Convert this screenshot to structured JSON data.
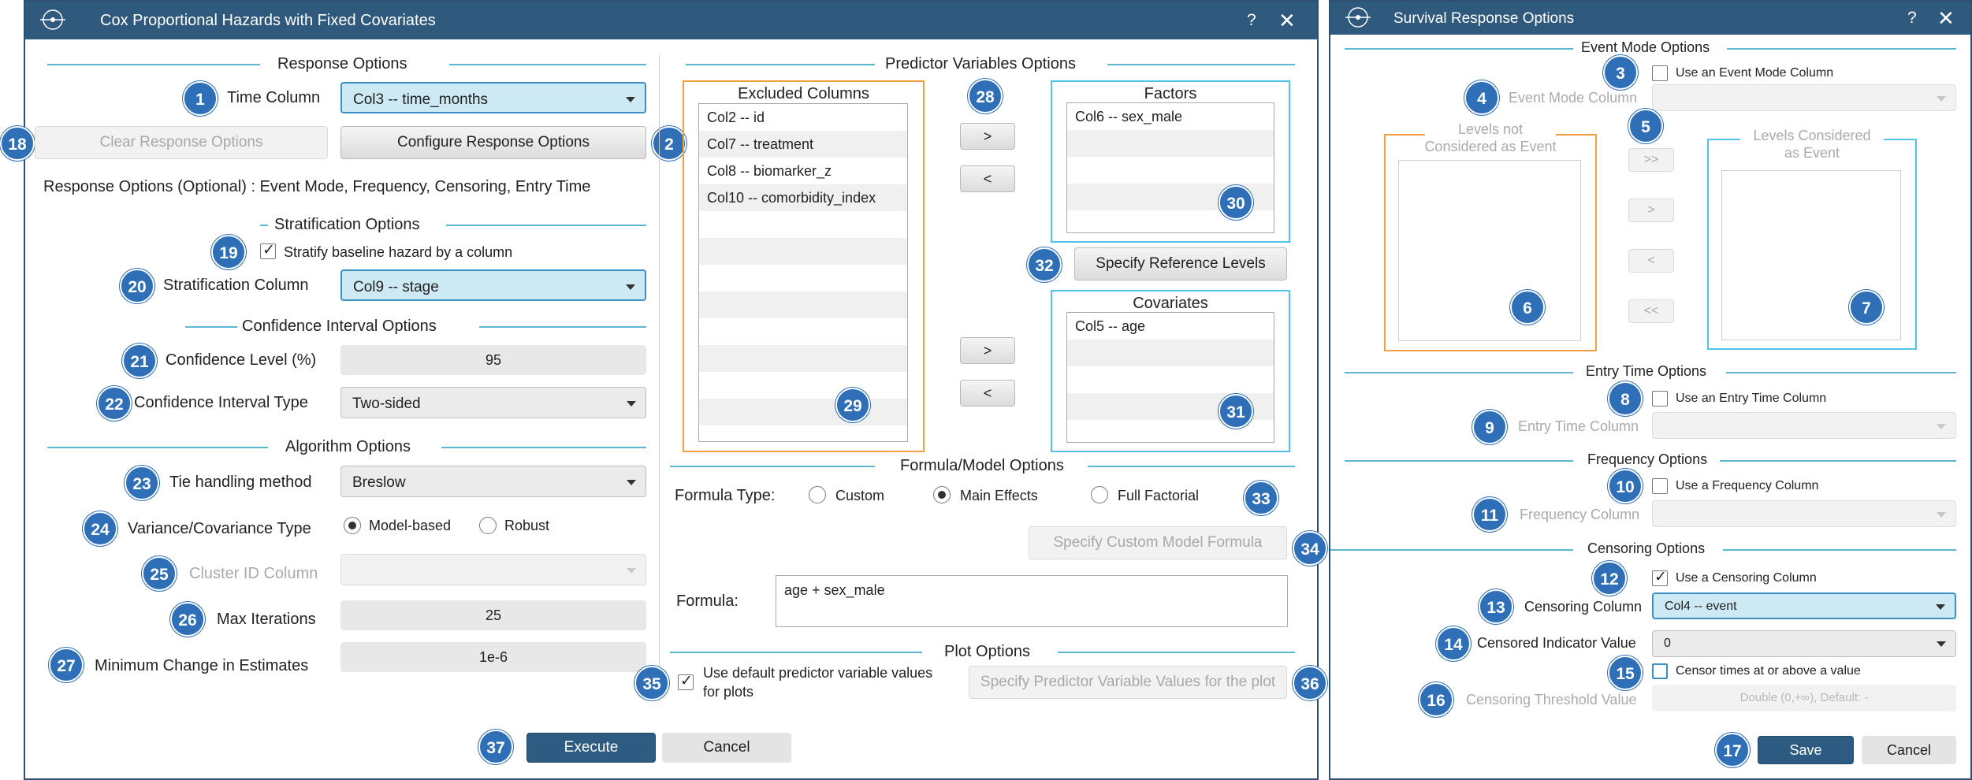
{
  "main": {
    "title": "Cox Proportional Hazards with Fixed Covariates",
    "help": "?",
    "close": "✕",
    "response": {
      "header": "Response Options",
      "time_label": "Time Column",
      "time_value": "Col3 -- time_months",
      "clear_btn": "Clear Response Options",
      "configure_btn": "Configure Response Options",
      "note": "Response Options (Optional) : Event Mode, Frequency, Censoring, Entry Time"
    },
    "strat": {
      "header": "Stratification Options",
      "check_label": "Stratify baseline hazard by a column",
      "col_label": "Stratification Column",
      "col_value": "Col9 -- stage"
    },
    "ci": {
      "header": "Confidence Interval Options",
      "level_label": "Confidence Level (%)",
      "level_value": "95",
      "type_label": "Confidence Interval Type",
      "type_value": "Two-sided"
    },
    "algo": {
      "header": "Algorithm Options",
      "tie_label": "Tie handling method",
      "tie_value": "Breslow",
      "var_label": "Variance/Covariance Type",
      "var_opt1": "Model-based",
      "var_opt2": "Robust",
      "cluster_label": "Cluster ID Column",
      "maxit_label": "Max Iterations",
      "maxit_value": "25",
      "minchg_label": "Minimum Change in Estimates",
      "minchg_value": "1e-6"
    },
    "predictors": {
      "header": "Predictor Variables Options",
      "excluded_title": "Excluded Columns",
      "excluded": [
        "Col2 -- id",
        "Col7 -- treatment",
        "Col8 -- biomarker_z",
        "Col10 -- comorbidity_index"
      ],
      "factors_title": "Factors",
      "factors": [
        "Col6 -- sex_male"
      ],
      "covariates_title": "Covariates",
      "covariates": [
        "Col5 -- age"
      ],
      "move_right": ">",
      "move_left": "<",
      "ref_btn": "Specify Reference Levels"
    },
    "formula": {
      "header": "Formula/Model Options",
      "type_label": "Formula Type:",
      "opt_custom": "Custom",
      "opt_main": "Main Effects",
      "opt_full": "Full Factorial",
      "custom_btn": "Specify Custom Model Formula",
      "formula_label": "Formula:",
      "formula_value": "age + sex_male"
    },
    "plot": {
      "header": "Plot Options",
      "check_label_1": "Use default predictor variable values",
      "check_label_2": "for plots",
      "values_btn": "Specify Predictor Variable Values for the plot"
    },
    "execute_btn": "Execute",
    "cancel_btn": "Cancel"
  },
  "resp": {
    "title": "Survival Response Options",
    "help": "?",
    "close": "✕",
    "event": {
      "header": "Event Mode Options",
      "check_label": "Use an Event Mode Column",
      "col_label": "Event Mode Column",
      "not_event_title_1": "Levels not",
      "not_event_title_2": "Considered as Event",
      "event_title_1": "Levels Considered",
      "event_title_2": "as Event",
      "btn_all_right": ">>",
      "btn_right": ">",
      "btn_left": "<",
      "btn_all_left": "<<"
    },
    "entry": {
      "header": "Entry Time Options",
      "check_label": "Use an Entry Time Column",
      "col_label": "Entry Time Column"
    },
    "freq": {
      "header": "Frequency Options",
      "check_label": "Use a Frequency Column",
      "col_label": "Frequency Column"
    },
    "cens": {
      "header": "Censoring Options",
      "check_label": "Use a Censoring Column",
      "col_label": "Censoring Column",
      "col_value": "Col4 -- event",
      "ind_label": "Censored Indicator Value",
      "ind_value": "0",
      "thresh_check_label": "Censor times at or above a value",
      "thresh_label": "Censoring Threshold Value",
      "thresh_placeholder": "Double (0,+∞), Default: -"
    },
    "save_btn": "Save",
    "cancel_btn": "Cancel"
  },
  "badges": {
    "b1": "1",
    "b2": "2",
    "b3": "3",
    "b4": "4",
    "b5": "5",
    "b6": "6",
    "b7": "7",
    "b8": "8",
    "b9": "9",
    "b10": "10",
    "b11": "11",
    "b12": "12",
    "b13": "13",
    "b14": "14",
    "b15": "15",
    "b16": "16",
    "b17": "17",
    "b18": "18",
    "b19": "19",
    "b20": "20",
    "b21": "21",
    "b22": "22",
    "b23": "23",
    "b24": "24",
    "b25": "25",
    "b26": "26",
    "b27": "27",
    "b28": "28",
    "b29": "29",
    "b30": "30",
    "b31": "31",
    "b32": "32",
    "b33": "33",
    "b34": "34",
    "b35": "35",
    "b36": "36",
    "b37": "37"
  },
  "colors": {
    "titlebar": "#2f5a7e",
    "badge": "#2e6fb8",
    "section_line": "#5bb8d0",
    "excluded_frame": "#f5a040",
    "included_frame": "#4fc3e8",
    "selected_combo": "#cde9f3"
  },
  "icons": {
    "app_logo": "app-logo-icon",
    "dropdown": "chevron-down-icon"
  }
}
